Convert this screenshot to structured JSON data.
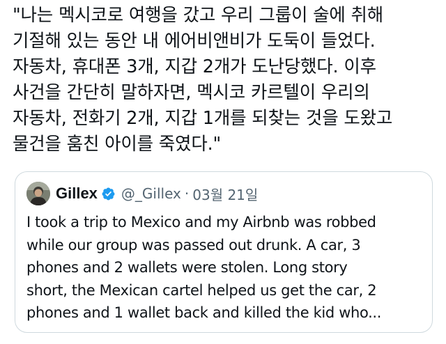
{
  "tweet": {
    "text": "\"나는 멕시코로 여행을 갔고 우리 그룹이 술에 취해\n기절해 있는 동안 내 에어비앤비가 도둑이 들었다.\n자동차, 휴대폰 3개, 지갑 2개가 도난당했다. 이후\n사건을 간단히 말하자면, 멕시코 카르텔이 우리의\n자동차, 전화기 2개, 지갑 1개를 되찾는 것을 도왔고\n물건을 훔친 아이를 죽였다.\""
  },
  "quote": {
    "display_name": "Gillex",
    "handle": "@_Gillex",
    "separator": "·",
    "date": "03월 21일",
    "verified_icon": "verified-badge-icon",
    "verified_color": "#1d9bf0",
    "text": "I took a trip to Mexico and my Airbnb was robbed\nwhile our group was passed out drunk. A car, 3\nphones and 2 wallets were stolen. Long story\nshort, the Mexican cartel helped us get the car, 2\nphones and 1 wallet back and killed the kid who..."
  },
  "colors": {
    "text_primary": "#0f1419",
    "text_secondary": "#536471",
    "card_border": "#cfd9de",
    "background": "#ffffff"
  }
}
